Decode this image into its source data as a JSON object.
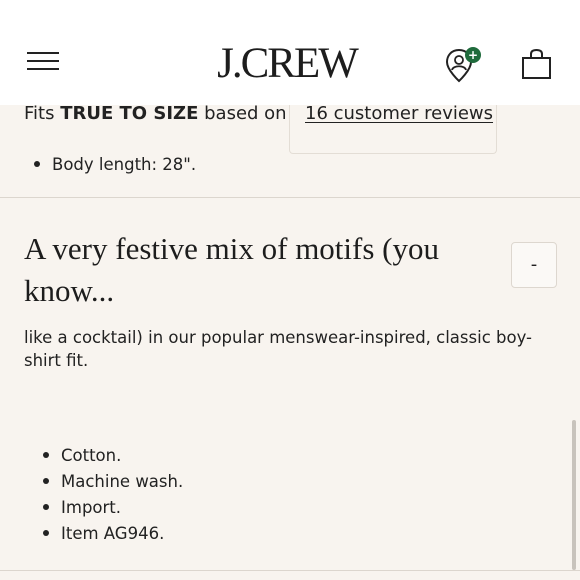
{
  "header": {
    "logo": "J.CREW",
    "menu_icon": "hamburger-menu-icon",
    "store_icon": "store-locator-icon",
    "store_badge": "+",
    "bag_icon": "shopping-bag-icon",
    "badge_color": "#1f6b3c"
  },
  "fit": {
    "prefix": "Fits ",
    "emphasis": "TRUE TO SIZE",
    "suffix": " based on",
    "reviews_link": "16 customer reviews"
  },
  "specs": {
    "body_length": "Body length: 28\"."
  },
  "product": {
    "headline": "A very festive mix of motifs (you know...",
    "toggle_label": "-",
    "description": "like a cocktail) in our popular menswear-inspired, classic boy-shirt fit.",
    "details": [
      "Cotton.",
      "Machine wash.",
      "Import.",
      "Item AG946."
    ]
  }
}
